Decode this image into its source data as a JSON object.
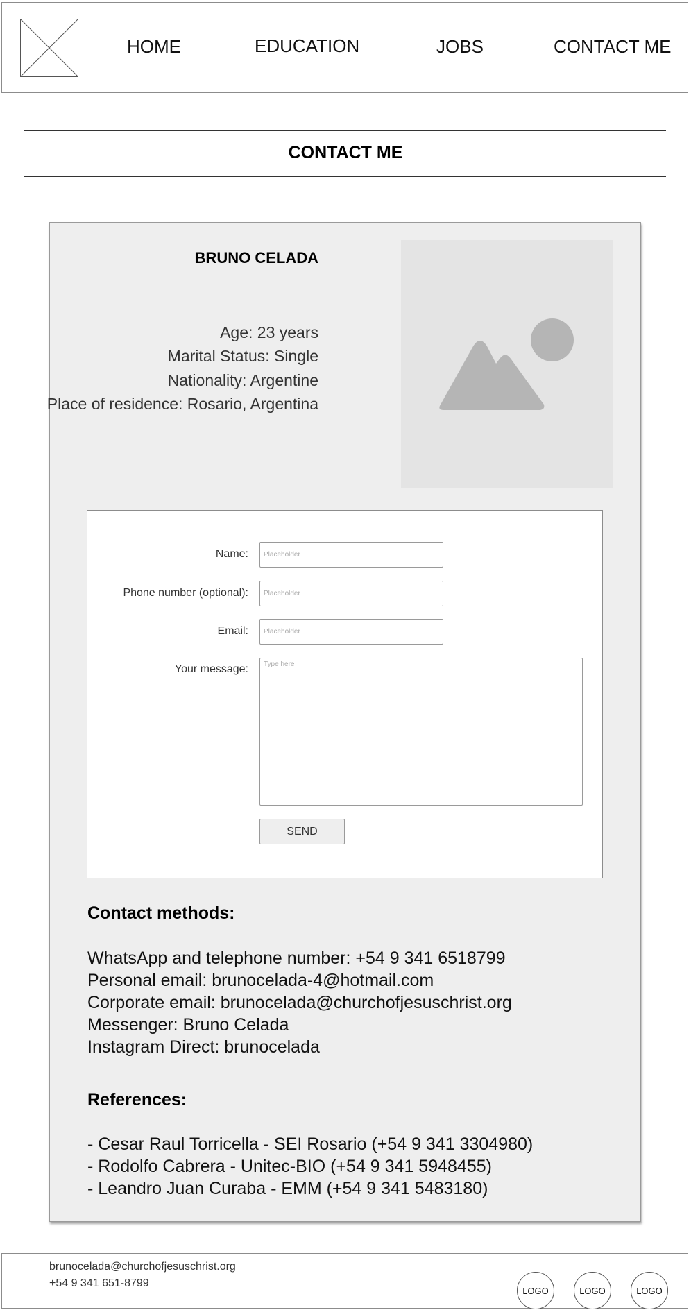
{
  "header": {
    "logo_icon": "placeholder-x-icon",
    "nav": [
      "HOME",
      "EDUCATION",
      "JOBS",
      "CONTACT ME"
    ]
  },
  "page": {
    "title": "CONTACT ME"
  },
  "profile": {
    "name": "BRUNO CELADA",
    "details": [
      "Age: 23 years",
      "Marital Status: Single",
      "Nationality: Argentine",
      "Place of residence: Rosario, Argentina"
    ],
    "photo_icon": "image-placeholder-icon"
  },
  "form": {
    "name_label": "Name:",
    "name_placeholder": "Placeholder",
    "phone_label": "Phone number (optional):",
    "phone_placeholder": "Placeholder",
    "email_label": "Email:",
    "email_placeholder": "Placeholder",
    "message_label": "Your message:",
    "message_placeholder": "Type here",
    "send_label": "SEND"
  },
  "contact_methods": {
    "heading": "Contact methods:",
    "lines": [
      "WhatsApp and telephone number: +54 9 341 6518799",
      "Personal email: brunocelada-4@hotmail.com",
      "Corporate email: brunocelada@churchofjesuschrist.org",
      "Messenger: Bruno Celada",
      "Instagram Direct: brunocelada"
    ]
  },
  "references": {
    "heading": "References:",
    "lines": [
      "- Cesar Raul Torricella - SEI Rosario (+54 9 341 3304980)",
      "- Rodolfo Cabrera - Unitec-BIO (+54 9 341 5948455)",
      "- Leandro Juan Curaba - EMM (+54 9 341 5483180)"
    ]
  },
  "footer": {
    "email": "brunocelada@churchofjesuschrist.org",
    "phone": "+54 9 341 651-8799",
    "logos": [
      "LOGO",
      "LOGO",
      "LOGO"
    ]
  },
  "colors": {
    "card_background": "#eeeeee",
    "photo_background": "#e4e4e4",
    "placeholder_shape": "#b5b5b5",
    "border": "#8c8c8c"
  }
}
